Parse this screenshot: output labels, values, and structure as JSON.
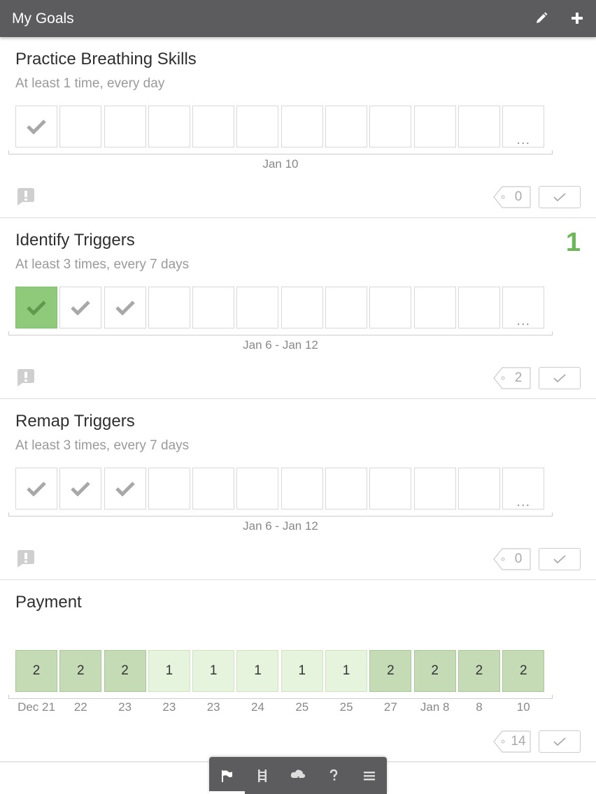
{
  "header": {
    "title": "My Goals",
    "edit_icon": "pencil-icon",
    "add_icon": "plus-icon"
  },
  "goals": [
    {
      "title": "Practice Breathing Skills",
      "subtitle": "At least 1 time, every day",
      "cells": [
        "check",
        "",
        "",
        "",
        "",
        "",
        "",
        "",
        "",
        "",
        "",
        "more"
      ],
      "range": "Jan 10",
      "tag_count": "0",
      "more_label": "..."
    },
    {
      "title": "Identify Triggers",
      "subtitle": "At least 3 times, every 7 days",
      "score": "1",
      "cells": [
        "done",
        "check",
        "check",
        "",
        "",
        "",
        "",
        "",
        "",
        "",
        "",
        "more"
      ],
      "range": "Jan 6 - Jan 12",
      "tag_count": "2",
      "more_label": "..."
    },
    {
      "title": "Remap Triggers",
      "subtitle": "At least 3 times, every 7 days",
      "cells": [
        "check",
        "check",
        "check",
        "",
        "",
        "",
        "",
        "",
        "",
        "",
        "",
        "more"
      ],
      "range": "Jan 6 - Jan 12",
      "tag_count": "0",
      "more_label": "..."
    }
  ],
  "payment": {
    "title": "Payment",
    "values": [
      "2",
      "2",
      "2",
      "1",
      "1",
      "1",
      "1",
      "1",
      "2",
      "2",
      "2",
      "2"
    ],
    "labels": [
      "Dec 21",
      "22",
      "23",
      "23",
      "23",
      "24",
      "25",
      "25",
      "27",
      "Jan 8",
      "8",
      "10"
    ],
    "tag_count": "14"
  },
  "colors": {
    "header_bg": "#5c5b5e",
    "accent_green": "#6cb856",
    "done_cell": "#8fc97a"
  },
  "bottom_nav": [
    {
      "icon": "flag-icon",
      "active": true
    },
    {
      "icon": "ladder-icon",
      "active": false
    },
    {
      "icon": "cloud-lightning-icon",
      "active": false
    },
    {
      "icon": "question-icon",
      "active": false
    },
    {
      "icon": "menu-icon",
      "active": false
    }
  ]
}
